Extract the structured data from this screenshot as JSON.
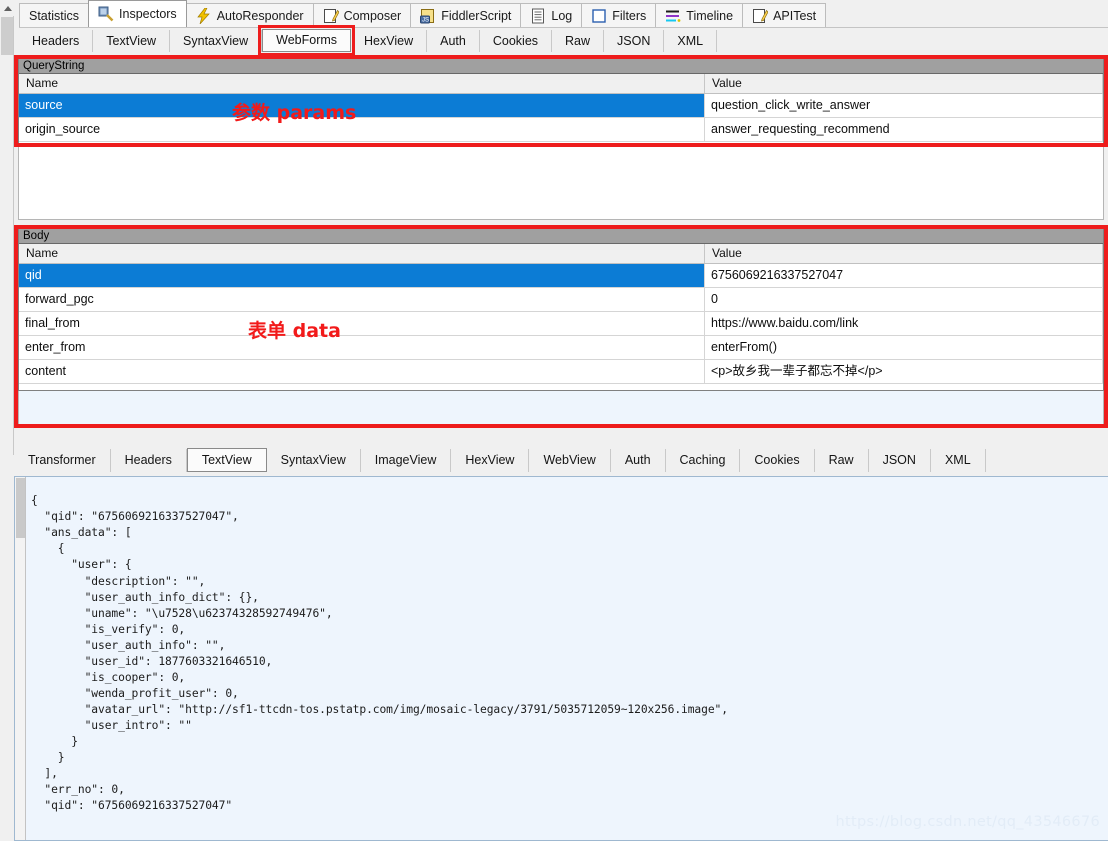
{
  "main_tabs": [
    {
      "label": "Statistics",
      "icon": "none",
      "active": false
    },
    {
      "label": "Inspectors",
      "icon": "magnifier-icon",
      "active": true
    },
    {
      "label": "AutoResponder",
      "icon": "lightning-icon",
      "active": false
    },
    {
      "label": "Composer",
      "icon": "pencil-note-icon",
      "active": false
    },
    {
      "label": "FiddlerScript",
      "icon": "js-script-icon",
      "active": false
    },
    {
      "label": "Log",
      "icon": "log-lines-icon",
      "active": false
    },
    {
      "label": "Filters",
      "icon": "filter-square-icon",
      "active": false
    },
    {
      "label": "Timeline",
      "icon": "timeline-bars-icon",
      "active": false
    },
    {
      "label": "APITest",
      "icon": "pencil-note-icon",
      "active": false
    }
  ],
  "request_tabs": [
    {
      "label": "Headers",
      "active": false,
      "highlighted": false
    },
    {
      "label": "TextView",
      "active": false,
      "highlighted": false
    },
    {
      "label": "SyntaxView",
      "active": false,
      "highlighted": false
    },
    {
      "label": "WebForms",
      "active": true,
      "highlighted": true
    },
    {
      "label": "HexView",
      "active": false,
      "highlighted": false
    },
    {
      "label": "Auth",
      "active": false,
      "highlighted": false
    },
    {
      "label": "Cookies",
      "active": false,
      "highlighted": false
    },
    {
      "label": "Raw",
      "active": false,
      "highlighted": false
    },
    {
      "label": "JSON",
      "active": false,
      "highlighted": false
    },
    {
      "label": "XML",
      "active": false,
      "highlighted": false
    }
  ],
  "querystring": {
    "title": "QueryString",
    "columns": [
      "Name",
      "Value"
    ],
    "annotation": "参数 params",
    "rows": [
      {
        "name": "source",
        "value": "question_click_write_answer",
        "selected": true
      },
      {
        "name": "origin_source",
        "value": "answer_requesting_recommend",
        "selected": false
      }
    ]
  },
  "body": {
    "title": "Body",
    "columns": [
      "Name",
      "Value"
    ],
    "annotation": "表单 data",
    "rows": [
      {
        "name": "qid",
        "value": "6756069216337527047",
        "selected": true
      },
      {
        "name": "forward_pgc",
        "value": "0",
        "selected": false
      },
      {
        "name": "final_from",
        "value": "https://www.baidu.com/link",
        "selected": false
      },
      {
        "name": "enter_from",
        "value": "enterFrom()",
        "selected": false
      },
      {
        "name": "content",
        "value": "<p>故乡我一辈子都忘不掉</p>",
        "selected": false
      }
    ]
  },
  "response_tabs": [
    {
      "label": "Transformer",
      "active": false
    },
    {
      "label": "Headers",
      "active": false
    },
    {
      "label": "TextView",
      "active": true
    },
    {
      "label": "SyntaxView",
      "active": false
    },
    {
      "label": "ImageView",
      "active": false
    },
    {
      "label": "HexView",
      "active": false
    },
    {
      "label": "WebView",
      "active": false
    },
    {
      "label": "Auth",
      "active": false
    },
    {
      "label": "Caching",
      "active": false
    },
    {
      "label": "Cookies",
      "active": false
    },
    {
      "label": "Raw",
      "active": false
    },
    {
      "label": "JSON",
      "active": false
    },
    {
      "label": "XML",
      "active": false
    }
  ],
  "response_body": {
    "text": "{\n  \"qid\": \"6756069216337527047\",\n  \"ans_data\": [\n    {\n      \"user\": {\n        \"description\": \"\",\n        \"user_auth_info_dict\": {},\n        \"uname\": \"\\u7528\\u62374328592749476\",\n        \"is_verify\": 0,\n        \"user_auth_info\": \"\",\n        \"user_id\": 1877603321646510,\n        \"is_cooper\": 0,\n        \"wenda_profit_user\": 0,\n        \"avatar_url\": \"http://sf1-ttcdn-tos.pstatp.com/img/mosaic-legacy/3791/5035712059~120x256.image\",\n        \"user_intro\": \"\"\n      }\n    }\n  ],\n  \"err_no\": 0,\n  \"qid\": \"6756069216337527047\""
  },
  "watermark": "https://blog.csdn.net/qq_43546676",
  "colors": {
    "selection_blue": "#0c7cd5",
    "annotation_red": "#ee1c1c",
    "section_header_gray": "#a0a0a0",
    "response_bg": "#eef5fd"
  }
}
